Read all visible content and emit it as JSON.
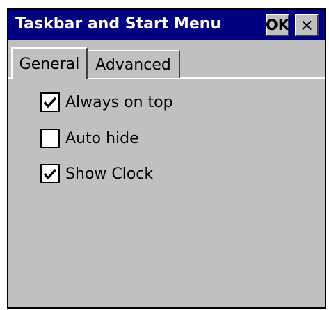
{
  "window": {
    "title": "Taskbar and Start Menu",
    "ok_label": "OK",
    "close_label": "×"
  },
  "tabs": [
    {
      "label": "General",
      "selected": true
    },
    {
      "label": "Advanced",
      "selected": false
    }
  ],
  "options": [
    {
      "label": "Always on top",
      "checked": true
    },
    {
      "label": "Auto hide",
      "checked": false
    },
    {
      "label": "Show Clock",
      "checked": true
    }
  ],
  "colors": {
    "titlebar": "#000080",
    "face": "#c0c0c0",
    "title_text": "#ffffff"
  }
}
